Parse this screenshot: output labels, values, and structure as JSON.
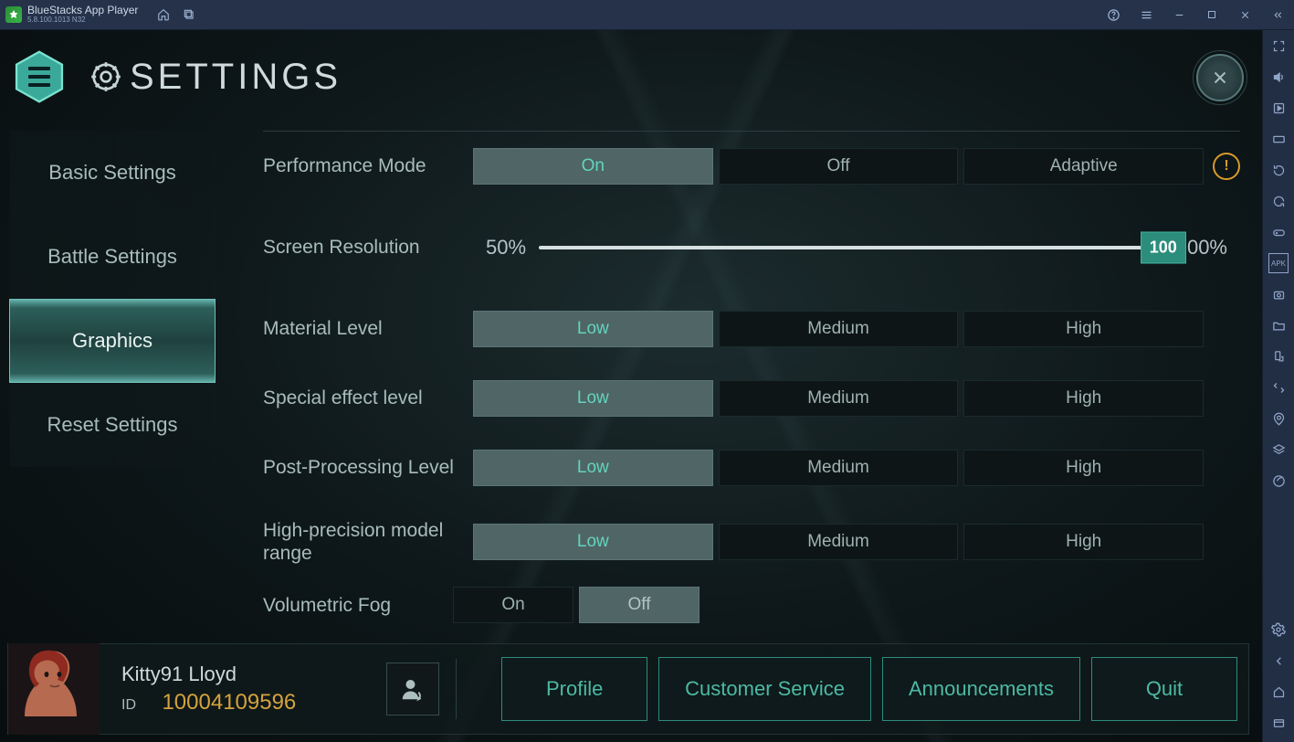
{
  "titlebar": {
    "app_name": "BlueStacks App Player",
    "version": "5.8.100.1013  N32"
  },
  "settings": {
    "title": "SETTINGS",
    "tabs": [
      "Basic Settings",
      "Battle Settings",
      "Graphics",
      "Reset Settings"
    ],
    "active_tab": 2,
    "rows": {
      "performance_mode": {
        "label": "Performance Mode",
        "options": [
          "On",
          "Off",
          "Adaptive"
        ],
        "selected": 0,
        "warn": true
      },
      "screen_resolution": {
        "label": "Screen Resolution",
        "min_label": "50%",
        "max_label": "100%",
        "value": 100
      },
      "material_level": {
        "label": "Material Level",
        "options": [
          "Low",
          "Medium",
          "High"
        ],
        "selected": 0
      },
      "special_effect_level": {
        "label": "Special effect level",
        "options": [
          "Low",
          "Medium",
          "High"
        ],
        "selected": 0
      },
      "post_processing_level": {
        "label": "Post-Processing Level",
        "options": [
          "Low",
          "Medium",
          "High"
        ],
        "selected": 0
      },
      "high_precision_model_range": {
        "label": "High-precision model range",
        "options": [
          "Low",
          "Medium",
          "High"
        ],
        "selected": 0
      },
      "volumetric_fog": {
        "label": "Volumetric Fog",
        "options": [
          "On",
          "Off"
        ],
        "selected": 1
      }
    }
  },
  "player": {
    "name": "Kitty91 Lloyd",
    "id_label": "ID",
    "id": "10004109596",
    "buttons": [
      "Profile",
      "Customer Service",
      "Announcements",
      "Quit"
    ]
  }
}
